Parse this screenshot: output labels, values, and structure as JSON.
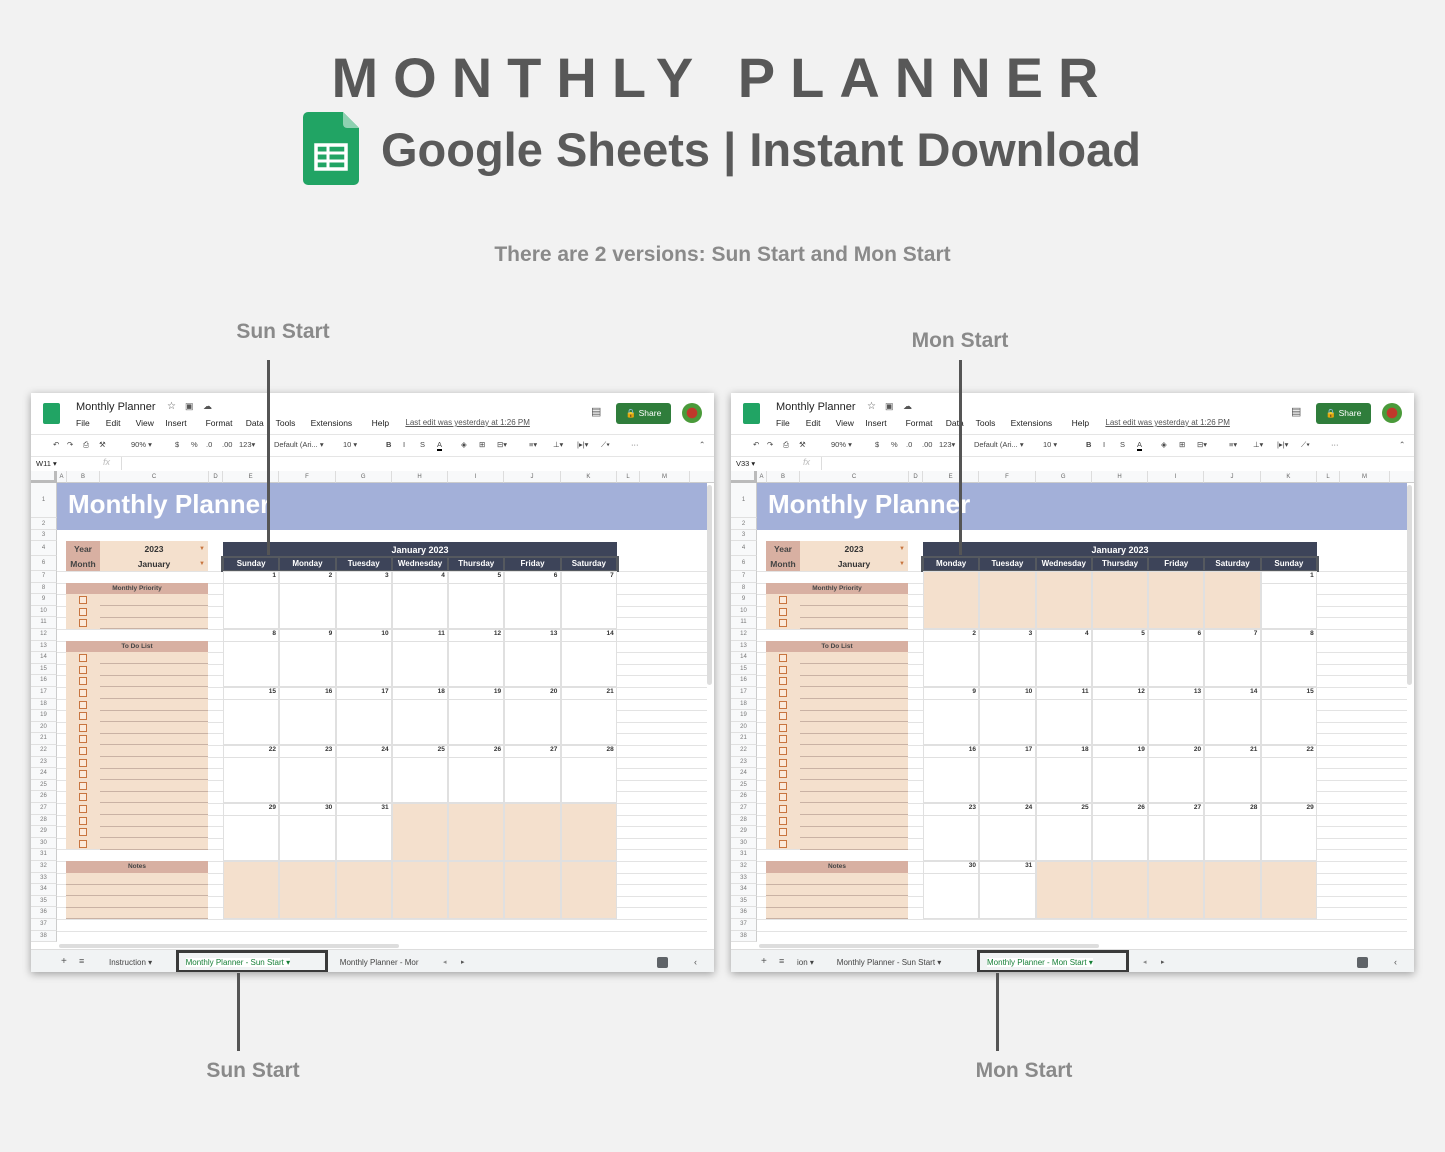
{
  "hero": {
    "title": "MONTHLY PLANNER",
    "subtitle": "Google Sheets | Instant Download",
    "versions_note": "There are 2 versions: Sun Start and Mon Start"
  },
  "callouts": {
    "top_left": "Sun Start",
    "top_right": "Mon Start",
    "bottom_left": "Sun Start",
    "bottom_right": "Mon Start"
  },
  "colors": {
    "banner": "#a3b0d9",
    "calendar_header": "#3d4459",
    "label_rose": "#d8b0a2",
    "fill_peach": "#f4e0cd",
    "checkbox": "#c8753f",
    "share_green": "#2f7d3b",
    "active_tab": "#188038"
  },
  "sheet_common": {
    "doc_title": "Monthly Planner",
    "menu": [
      "File",
      "Edit",
      "View",
      "Insert",
      "Format",
      "Data",
      "Tools",
      "Extensions",
      "Help"
    ],
    "last_edit": "Last edit was yesterday at 1:26 PM",
    "share_label": "Share",
    "toolbar": {
      "zoom": "90%",
      "currency": "$",
      "percent": "%",
      "dec_less": ".0",
      "dec_more": ".00",
      "format": "123",
      "font": "Default (Ari...",
      "font_size": "10",
      "bold": "B",
      "italic": "I",
      "strike": "S",
      "text_color": "A",
      "more": "···"
    },
    "fx": "fx",
    "columns": [
      "A",
      "B",
      "C",
      "D",
      "E",
      "F",
      "G",
      "H",
      "I",
      "J",
      "K",
      "L",
      "M"
    ],
    "banner_title": "Monthly Planner",
    "year_label": "Year",
    "year_value": "2023",
    "month_label": "Month",
    "month_value": "January",
    "priority_header": "Monthly Priority",
    "todo_header": "To Do List",
    "notes_header": "Notes",
    "calendar_title": "January 2023"
  },
  "sheets": [
    {
      "cell_ref": "W11",
      "weekdays": [
        "Sunday",
        "Monday",
        "Tuesday",
        "Wednesday",
        "Thursday",
        "Friday",
        "Saturday"
      ],
      "weeks": [
        [
          1,
          2,
          3,
          4,
          5,
          6,
          7
        ],
        [
          8,
          9,
          10,
          11,
          12,
          13,
          14
        ],
        [
          15,
          16,
          17,
          18,
          19,
          20,
          21
        ],
        [
          22,
          23,
          24,
          25,
          26,
          27,
          28
        ],
        [
          29,
          30,
          31,
          null,
          null,
          null,
          null
        ],
        [
          null,
          null,
          null,
          null,
          null,
          null,
          null
        ]
      ],
      "tabs": [
        {
          "label": "Instruction",
          "active": false
        },
        {
          "label": "Monthly Planner - Sun Start",
          "active": true
        },
        {
          "label": "Monthly Planner - Mor",
          "active": false
        }
      ]
    },
    {
      "cell_ref": "V33",
      "weekdays": [
        "Monday",
        "Tuesday",
        "Wednesday",
        "Thursday",
        "Friday",
        "Saturday",
        "Sunday"
      ],
      "weeks": [
        [
          null,
          null,
          null,
          null,
          null,
          null,
          1
        ],
        [
          2,
          3,
          4,
          5,
          6,
          7,
          8
        ],
        [
          9,
          10,
          11,
          12,
          13,
          14,
          15
        ],
        [
          16,
          17,
          18,
          19,
          20,
          21,
          22
        ],
        [
          23,
          24,
          25,
          26,
          27,
          28,
          29
        ],
        [
          30,
          31,
          null,
          null,
          null,
          null,
          null
        ]
      ],
      "tabs": [
        {
          "label": "ion",
          "active": false
        },
        {
          "label": "Monthly Planner - Sun Start",
          "active": false
        },
        {
          "label": "Monthly Planner - Mon Start",
          "active": true
        }
      ]
    }
  ]
}
